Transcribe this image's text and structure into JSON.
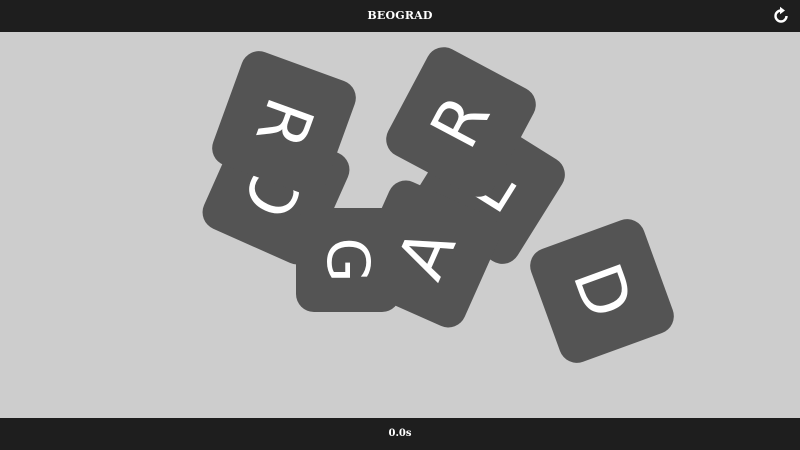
{
  "header": {
    "title": "BEOGRAD",
    "reset_icon": "reset-icon"
  },
  "tiles": [
    {
      "letter": "O"
    },
    {
      "letter": "R"
    },
    {
      "letter": "E"
    },
    {
      "letter": "R"
    },
    {
      "letter": "G"
    },
    {
      "letter": "A"
    },
    {
      "letter": "D"
    }
  ],
  "footer": {
    "timer": "0.0s"
  },
  "colors": {
    "bar": "#1e1e1e",
    "board": "#cdcdcd",
    "tile": "#545454",
    "tile_text": "#ffffff"
  }
}
